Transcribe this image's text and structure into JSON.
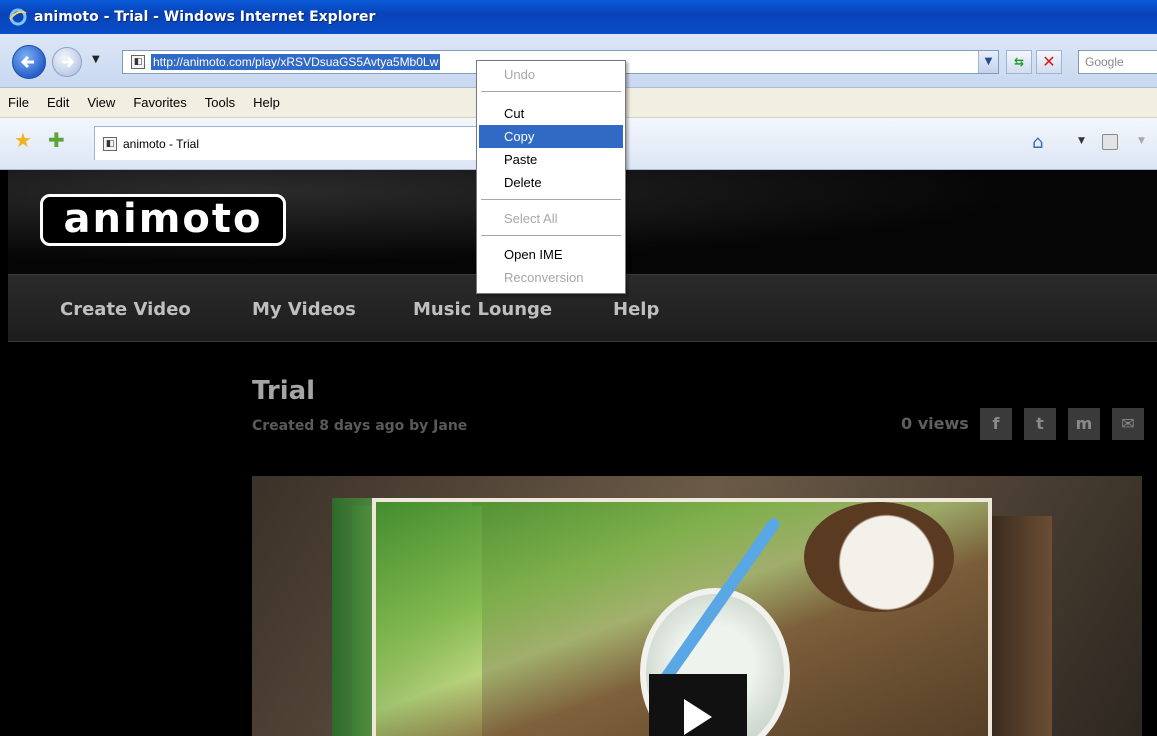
{
  "window": {
    "title": "animoto - Trial - Windows Internet Explorer"
  },
  "address_bar": {
    "url": "http://animoto.com/play/xRSVDsuaGS5Avtya5Mb0Lw",
    "search_placeholder": "Google"
  },
  "menu_bar": {
    "items": [
      "File",
      "Edit",
      "View",
      "Favorites",
      "Tools",
      "Help"
    ]
  },
  "tab": {
    "label": "animoto - Trial"
  },
  "context_menu": {
    "undo": "Undo",
    "cut": "Cut",
    "copy": "Copy",
    "paste": "Paste",
    "delete": "Delete",
    "select_all": "Select All",
    "open_ime": "Open IME",
    "reconversion": "Reconversion",
    "selected_item": "Copy"
  },
  "site": {
    "logo": "animoto",
    "nav": [
      "Create Video",
      "My Videos",
      "Music Lounge",
      "Help"
    ],
    "video_title": "Trial",
    "video_meta": "Created 8 days ago by Jane",
    "views": "0 views",
    "share": {
      "facebook": "f",
      "twitter": "t",
      "myspace": "m",
      "email": "✉"
    }
  },
  "icons": {
    "back": "back-arrow-icon",
    "forward": "forward-arrow-icon",
    "refresh": "refresh-icon",
    "stop": "stop-icon",
    "favorites": "favorites-star-icon",
    "add_favorites": "add-favorites-icon",
    "home": "home-icon",
    "feeds": "feeds-icon",
    "play": "play-icon"
  },
  "colors": {
    "titlebar": "#0a4ec9",
    "selection": "#316ac5",
    "site_bg": "#000000"
  }
}
